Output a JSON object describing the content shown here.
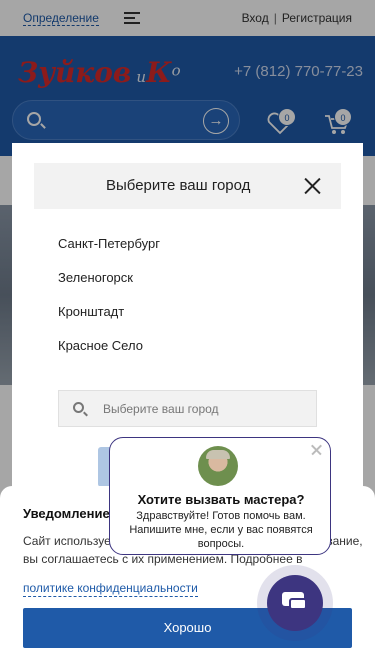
{
  "topbar": {
    "definition_link": "Определение",
    "login": "Вход",
    "separator": "|",
    "register": "Регистрация"
  },
  "header": {
    "logo_part1": "Зуйков",
    "logo_part2": "и",
    "logo_part3": "К",
    "logo_part4": "о",
    "phone": "+7 (812) 770-77-23",
    "search_arrow": "→",
    "favorites_count": "0",
    "cart_count": "0"
  },
  "city_modal": {
    "title": "Выберите ваш город",
    "cities": [
      "Санкт-Петербург",
      "Зеленогорск",
      "Кронштадт",
      "Красное Село"
    ],
    "search_placeholder": "Выберите ваш город"
  },
  "cookie": {
    "title": "Уведомление",
    "text": "Сайт использует файлы cookies. Продолжая использование, вы соглашаетесь с их применением. Подробнее в",
    "link": "политике конфиденциальности",
    "button": "Хорошо"
  },
  "chat_popup": {
    "title": "Хотите вызвать мастера?",
    "text": "Здравствуйте! Готов помочь вам. Напишите мне, если у вас появятся вопросы."
  },
  "colors": {
    "brand_blue": "#1f5aa8",
    "chat_purple": "#3d3580",
    "logo_red": "#d82a2a"
  }
}
